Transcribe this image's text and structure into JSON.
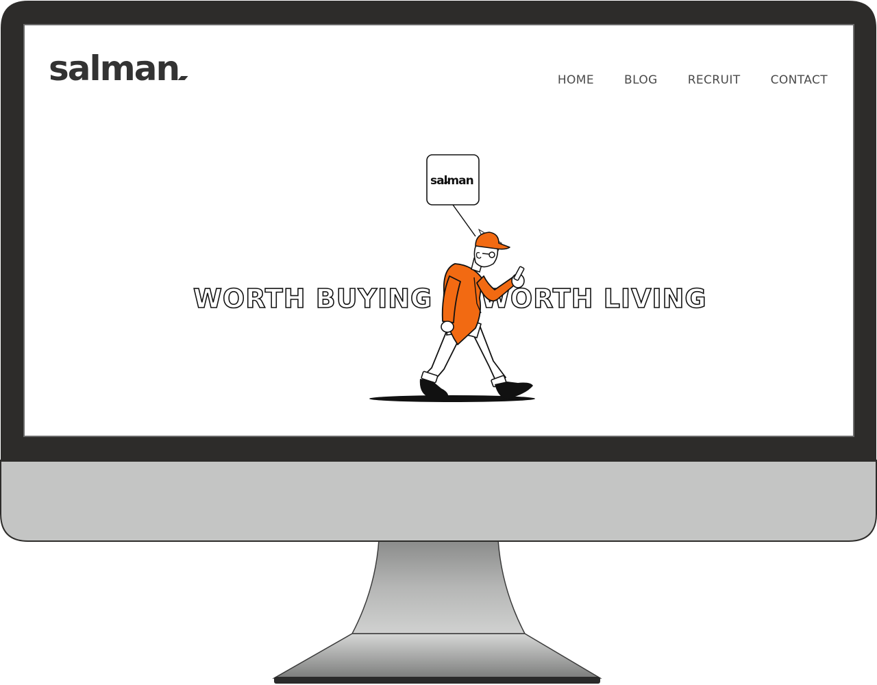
{
  "site": {
    "logo": "salman",
    "nav": [
      {
        "label": "HOME"
      },
      {
        "label": "BLOG"
      },
      {
        "label": "RECRUIT"
      },
      {
        "label": "CONTACT"
      }
    ]
  },
  "hero": {
    "headline_left": "WORTH BUYING",
    "headline_right": "WORTH LIVING",
    "sign_text": "salman",
    "illustration": "walking-man-with-smartphone"
  },
  "colors": {
    "bezel": "#2d2c2a",
    "chin": "#c4c5c4",
    "accent_orange": "#f26a12",
    "text_dark": "#333333",
    "nav_text": "#4a4a4a"
  }
}
